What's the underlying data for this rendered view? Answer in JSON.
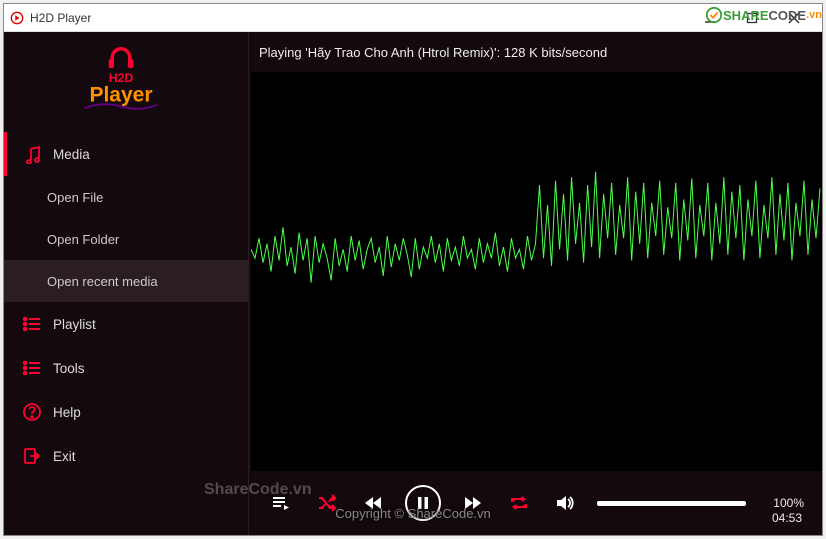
{
  "window": {
    "title": "H2D Player"
  },
  "logo": {
    "line1": "H2D",
    "line2": "Player"
  },
  "menu": {
    "media": "Media",
    "open_file": "Open File",
    "open_folder": "Open Folder",
    "open_recent": "Open recent media",
    "playlist": "Playlist",
    "tools": "Tools",
    "help": "Help",
    "exit": "Exit"
  },
  "playback": {
    "status": "Playing 'Hãy Trao Cho Anh (Htrol Remix)': 128 K bits/second",
    "volume_percent": "100%",
    "elapsed": "04:53"
  },
  "copyright": "Copyright © ShareCode.vn",
  "watermark": "ShareCode.vn",
  "top_watermark_a": "SHARE",
  "top_watermark_b": "CODE",
  "top_watermark_c": ".vn"
}
